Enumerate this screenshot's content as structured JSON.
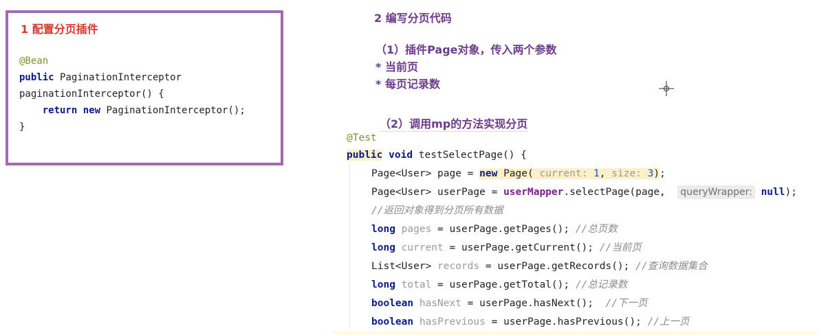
{
  "left_box": {
    "title": "1 配置分页插件",
    "code": [
      {
        "anno": "@Bean"
      },
      {
        "kw": "public",
        "rest": " PaginationInterceptor"
      },
      {
        "rest": "paginationInterceptor() {"
      },
      {
        "indent": "    ",
        "kw": "return",
        "kw2": "new",
        "rest": " PaginationInterceptor();"
      },
      {
        "rest": "}"
      }
    ]
  },
  "right": {
    "heading": "2 编写分页代码",
    "step1": "（1）插件Page对象，传入两个参数",
    "bullet1": "* 当前页",
    "bullet2": "* 每页记录数",
    "step2": "（2）调用mp的方法实现分页",
    "code": {
      "annotation": "@Test",
      "l1_kw1": "public",
      "l1_kw2": "void",
      "l1_rest": " testSelectPage() {",
      "l2_a": "Page<User> page = ",
      "l2_new": "new",
      "l2_page": " Page(",
      "l2_hint1": "current:",
      "l2_v1": "1",
      "l2_sep": ", ",
      "l2_hint2": "size:",
      "l2_v2": "3",
      "l2_close": ")",
      "l2_end": ";",
      "l3_a": "Page<User> userPage = ",
      "l3_mapper": "userMapper",
      "l3_b": ".selectPage(page, ",
      "l3_hint": "queryWrapper:",
      "l3_null": "null",
      "l3_end": ");",
      "l4_comment": "//返回对象得到分页所有数据",
      "l5_kw": "long",
      "l5_var": "pages",
      "l5_rest": " = userPage.getPages(); ",
      "l5_comment": "//总页数",
      "l6_kw": "long",
      "l6_var": "current",
      "l6_rest": " = userPage.getCurrent(); ",
      "l6_comment": "//当前页",
      "l7_type": "List<User> ",
      "l7_var": "records",
      "l7_rest": " = userPage.getRecords(); ",
      "l7_comment": "//查询数据集合",
      "l8_kw": "long",
      "l8_var": "total",
      "l8_rest": " = userPage.getTotal(); ",
      "l8_comment": "//总记录数",
      "l9_kw": "boolean",
      "l9_var": "hasNext",
      "l9_rest": " = userPage.hasNext();  ",
      "l9_comment": "//下一页",
      "l10_kw": "boolean",
      "l10_var": "hasPrevious",
      "l10_rest": " = userPage.hasPrevious(); ",
      "l10_comment": "//上一页"
    }
  }
}
